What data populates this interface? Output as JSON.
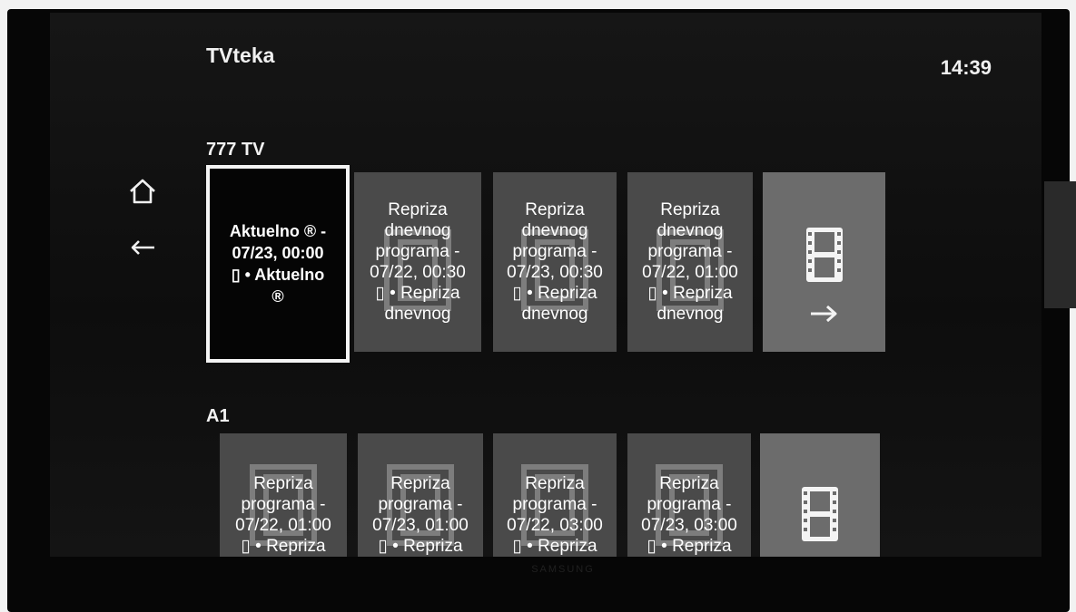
{
  "header": {
    "app_title": "TVteka",
    "clock": "14:39"
  },
  "nav": {
    "home_icon": "home-icon",
    "back_icon": "back-arrow-icon"
  },
  "rows": [
    {
      "channel": "777 TV",
      "tiles": [
        {
          "label": "Aktuelno ® -\n07/23, 00:00\n▯ • Aktuelno\n®",
          "focused": true
        },
        {
          "label": "Repriza\ndnevnog\nprograma -\n07/22, 00:30\n▯ • Repriza\ndnevnog"
        },
        {
          "label": "Repriza\ndnevnog\nprograma -\n07/23, 00:30\n▯ • Repriza\ndnevnog"
        },
        {
          "label": "Repriza\ndnevnog\nprograma -\n07/22, 01:00\n▯ • Repriza\ndnevnog"
        }
      ],
      "more_icon": "film-icon"
    },
    {
      "channel": "A1",
      "tiles": [
        {
          "label": "Repriza\nprograma -\n07/22, 01:00\n▯ • Repriza"
        },
        {
          "label": "Repriza\nprograma -\n07/23, 01:00\n▯ • Repriza"
        },
        {
          "label": "Repriza\nprograma -\n07/22, 03:00\n▯ • Repriza"
        },
        {
          "label": "Repriza\nprograma -\n07/23, 03:00\n▯ • Repriza"
        }
      ],
      "more_icon": "film-icon"
    }
  ],
  "colors": {
    "tile_bg": "#4a4a4a",
    "more_tile_bg": "#6c6c6c",
    "focus_border": "#f4f4f4",
    "text": "#ffffff"
  },
  "tv_brand": "SAMSUNG"
}
